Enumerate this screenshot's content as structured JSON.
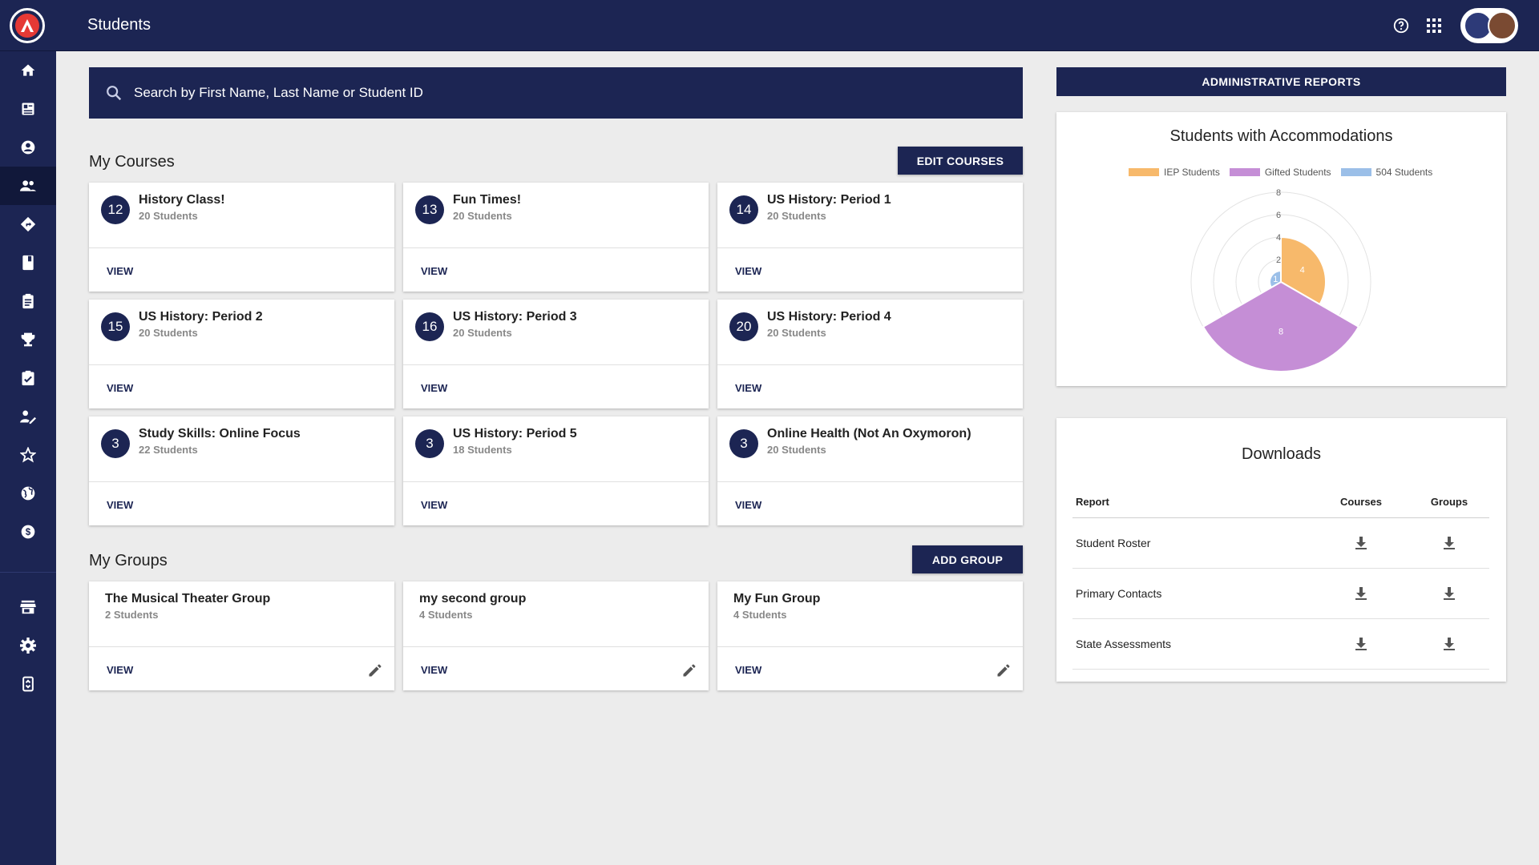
{
  "header": {
    "title": "Students",
    "help_icon": "help-circle-icon",
    "apps_icon": "apps-grid-icon",
    "brand_color": "#1c2553"
  },
  "sidebar": {
    "items": [
      {
        "icon": "home-icon"
      },
      {
        "icon": "dashboard-icon"
      },
      {
        "icon": "account-circle-icon"
      },
      {
        "icon": "people-icon",
        "active": true
      },
      {
        "icon": "directions-icon"
      },
      {
        "icon": "book-icon"
      },
      {
        "icon": "clipboard-icon"
      },
      {
        "icon": "trophy-icon"
      },
      {
        "icon": "assignment-check-icon"
      },
      {
        "icon": "person-edit-icon"
      },
      {
        "icon": "star-icon"
      },
      {
        "icon": "globe-icon"
      },
      {
        "icon": "dollar-icon"
      },
      {
        "icon": "store-icon"
      },
      {
        "icon": "settings-icon"
      },
      {
        "icon": "badge-scan-icon"
      }
    ]
  },
  "search": {
    "placeholder": "Search by First Name, Last Name or Student ID"
  },
  "courses": {
    "title": "My Courses",
    "edit_label": "EDIT COURSES",
    "view_label": "VIEW",
    "items": [
      {
        "badge": "12",
        "name": "History Class!",
        "students": "20 Students"
      },
      {
        "badge": "13",
        "name": "Fun Times!",
        "students": "20 Students"
      },
      {
        "badge": "14",
        "name": "US History: Period 1",
        "students": "20 Students"
      },
      {
        "badge": "15",
        "name": "US History: Period 2",
        "students": "20 Students"
      },
      {
        "badge": "16",
        "name": "US History: Period 3",
        "students": "20 Students"
      },
      {
        "badge": "20",
        "name": "US History: Period 4",
        "students": "20 Students"
      },
      {
        "badge": "3",
        "name": "Study Skills: Online Focus",
        "students": "22 Students"
      },
      {
        "badge": "3",
        "name": "US History: Period 5",
        "students": "18 Students"
      },
      {
        "badge": "3",
        "name": "Online Health (Not An Oxymoron)",
        "students": "20 Students"
      }
    ]
  },
  "groups": {
    "title": "My Groups",
    "add_label": "ADD GROUP",
    "view_label": "VIEW",
    "items": [
      {
        "name": "The Musical Theater Group",
        "students": "2 Students"
      },
      {
        "name": "my second group",
        "students": "4 Students"
      },
      {
        "name": "My Fun Group",
        "students": "4 Students"
      }
    ]
  },
  "admin_reports": {
    "label": "ADMINISTRATIVE REPORTS"
  },
  "chart_data": {
    "type": "polar-area",
    "title": "Students with Accommodations",
    "series": [
      {
        "name": "IEP Students",
        "value": 4,
        "color": "#f7b96b"
      },
      {
        "name": "Gifted Students",
        "value": 8,
        "color": "#c58ed6"
      },
      {
        "name": "504 Students",
        "value": 1,
        "color": "#9bbfe8"
      }
    ],
    "rlim": [
      0,
      8
    ],
    "ticks": [
      "8",
      "6",
      "4",
      "2"
    ],
    "data_labels": [
      "4",
      "8",
      "1"
    ],
    "legend_position": "top"
  },
  "downloads": {
    "title": "Downloads",
    "headers": {
      "report": "Report",
      "courses": "Courses",
      "groups": "Groups"
    },
    "rows": [
      {
        "report": "Student Roster"
      },
      {
        "report": "Primary Contacts"
      },
      {
        "report": "State Assessments"
      }
    ],
    "icon": "download-icon"
  }
}
